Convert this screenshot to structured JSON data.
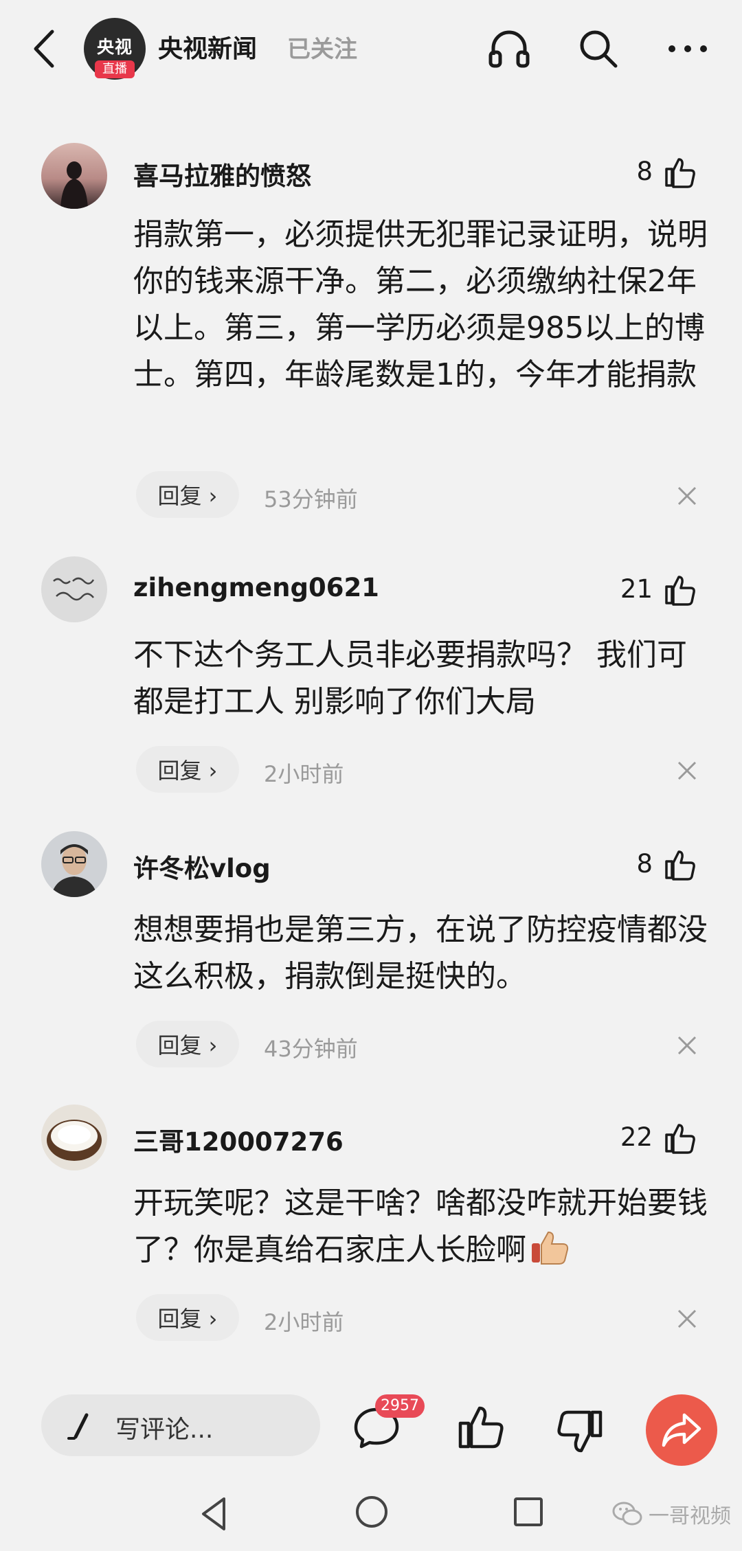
{
  "header": {
    "channel_logo_text": "央视",
    "live_badge": "直播",
    "channel_name": "央视新闻",
    "follow_status": "已关注"
  },
  "comments": [
    {
      "username": "喜马拉雅的愤怒",
      "likes": "8",
      "text": "捐款第一，必须提供无犯罪记录证明，说明你的钱来源干净。第二，必须缴纳社保2年以上。第三，第一学历必须是985以上的博士。第四，年龄尾数是1的，今年才能捐款",
      "reply_label": "回复 ›",
      "time": "53分钟前"
    },
    {
      "username": "zihengmeng0621",
      "likes": "21",
      "text": "不下达个务工人员非必要捐款吗？ 我们可都是打工人 别影响了你们大局",
      "reply_label": "回复 ›",
      "time": "2小时前"
    },
    {
      "username": "许冬松vlog",
      "likes": "8",
      "text": "想想要捐也是第三方，在说了防控疫情都没这么积极，捐款倒是挺快的。",
      "reply_label": "回复 ›",
      "time": "43分钟前"
    },
    {
      "username": "三哥120007276",
      "likes": "22",
      "text": "开玩笑呢？这是干啥？啥都没咋就开始要钱了？你是真给石家庄人长脸啊",
      "reply_label": "回复 ›",
      "time": "2小时前"
    }
  ],
  "bottom_bar": {
    "write_placeholder": "写评论...",
    "comment_count": "2957"
  },
  "watermark": {
    "text": "一哥视频"
  },
  "colors": {
    "background": "#f2f2f2",
    "badge_red": "#e84a57",
    "share_orange": "#ec5a4b",
    "muted_gray": "#9a9a9a"
  }
}
